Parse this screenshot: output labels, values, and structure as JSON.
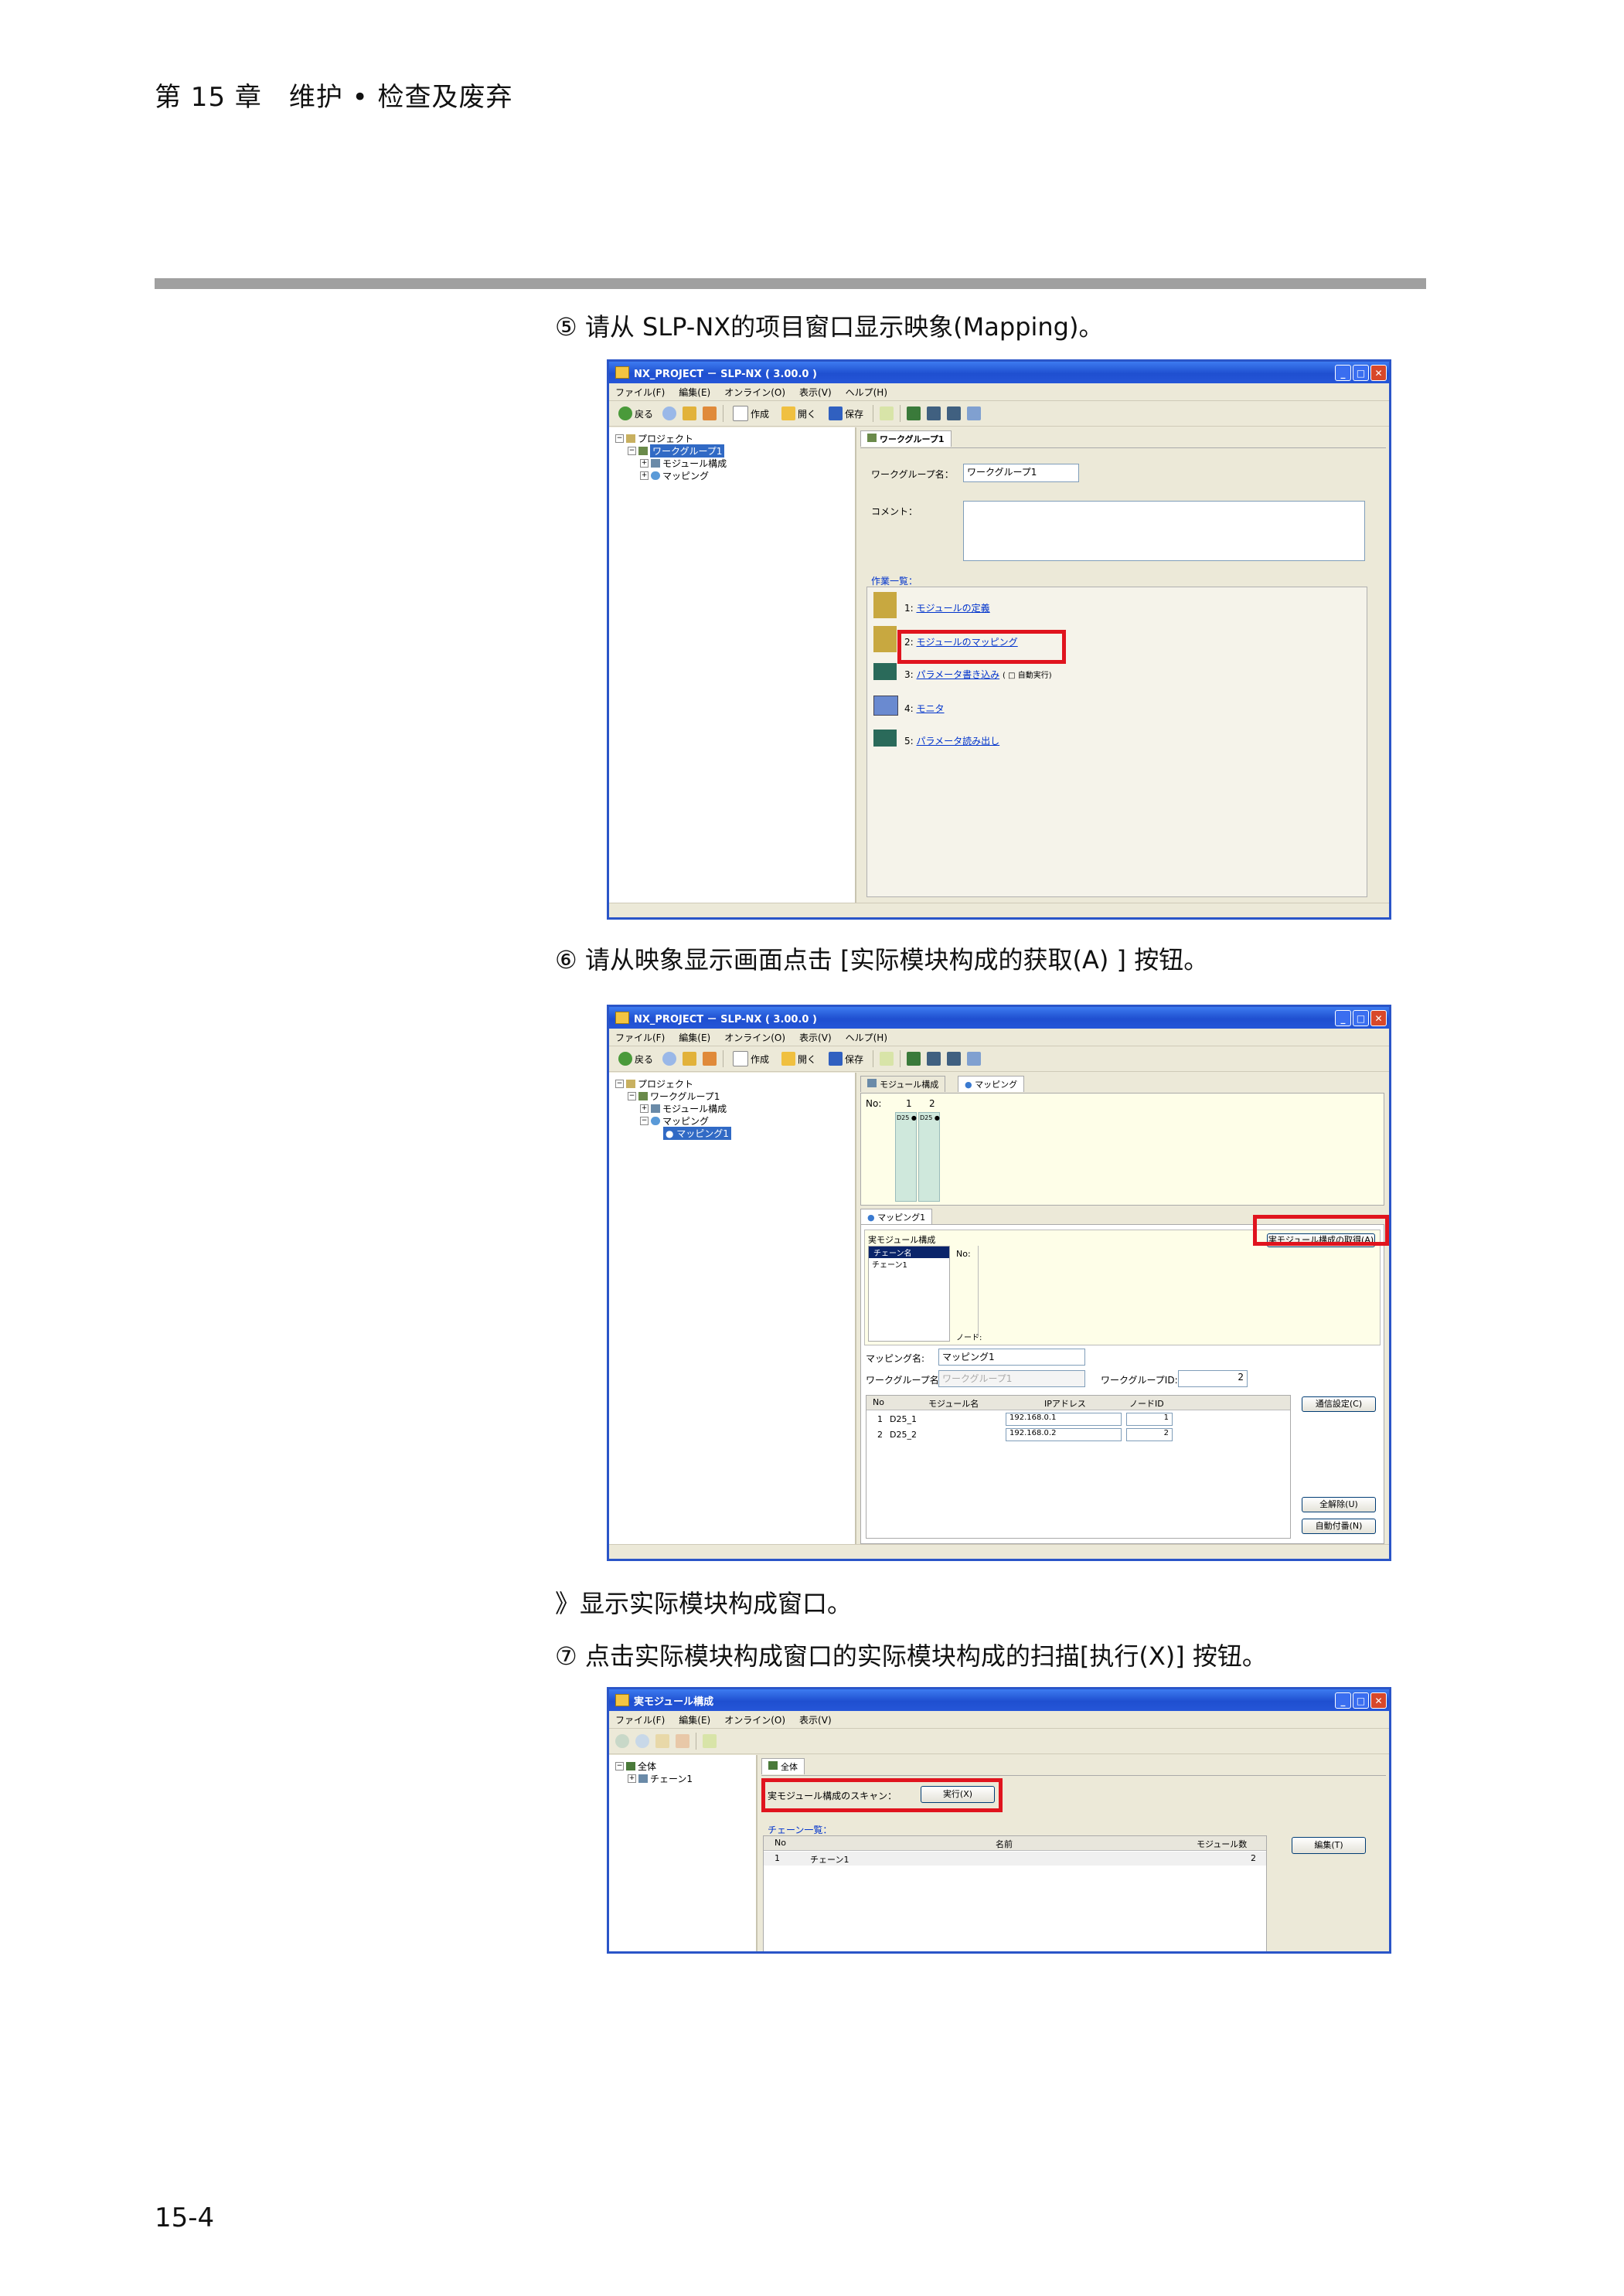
{
  "header": {
    "chapter": "第 15 章　维护 • 检查及废弃"
  },
  "steps": {
    "s5": "⑤ 请从 SLP-NX的项目窗口显示映象(Mapping)。",
    "s6": "⑥ 请从映象显示画面点击 [实际模块构成的获取(A) ] 按钮。",
    "result": "》显示实际模块构成窗口。",
    "s7": "⑦ 点击实际模块构成窗口的实际模块构成的扫描[执行(X)] 按钮。"
  },
  "screen1": {
    "title": "NX_PROJECT － SLP-NX ( 3.00.0 )",
    "menu": [
      "ファイル(F)",
      "編集(E)",
      "オンライン(O)",
      "表示(V)",
      "ヘルプ(H)"
    ],
    "toolbar": {
      "back": "戻る",
      "create": "作成",
      "open": "開く",
      "save": "保存"
    },
    "tree": [
      "プロジェクト",
      "ワークグループ1",
      "モジュール構成",
      "マッピング"
    ],
    "panel_title": "ワークグループ1",
    "name_label": "ワークグループ名：",
    "name_value": "ワークグループ1",
    "comment_label": "コメント：",
    "tasks_label": "作業一覧：",
    "tasks": [
      {
        "num": "1:",
        "text": "モジュールの定義",
        "extra": ""
      },
      {
        "num": "2:",
        "text": "モジュールのマッピング",
        "extra": ""
      },
      {
        "num": "3:",
        "text": "パラメータ書き込み",
        "extra": "( □ 自動実行)"
      },
      {
        "num": "4:",
        "text": "モニタ",
        "extra": ""
      },
      {
        "num": "5:",
        "text": "パラメータ読み出し",
        "extra": ""
      }
    ]
  },
  "screen2": {
    "title": "NX_PROJECT － SLP-NX ( 3.00.0 )",
    "menu": [
      "ファイル(F)",
      "編集(E)",
      "オンライン(O)",
      "表示(V)",
      "ヘルプ(H)"
    ],
    "toolbar": {
      "back": "戻る",
      "create": "作成",
      "open": "開く",
      "save": "保存"
    },
    "tree": [
      "プロジェクト",
      "ワークグループ1",
      "モジュール構成",
      "マッピング",
      "マッピング1"
    ],
    "tabs": [
      "モジュール構成",
      "マッピング"
    ],
    "no_label": "No:",
    "slots": [
      "1",
      "2"
    ],
    "slot_tags": [
      "D25 ●",
      "D25 ●"
    ],
    "mapping_tab": "マッピング1",
    "real_module_label": "実モジュール構成",
    "acquire_button": "実モジュール構成の取得(A)",
    "chain_header": "チェーン名",
    "chain_item": "チェーン1",
    "node_label": "ノード:",
    "mapping_name_label": "マッピング名:",
    "mapping_name_value": "マッピング1",
    "workgroup_name_label": "ワークグループ名:",
    "workgroup_name_value": "ワークグループ1",
    "workgroup_id_label": "ワークグループID:",
    "workgroup_id_value": "2",
    "table_headers": [
      "No",
      "モジュール名",
      "IPアドレス",
      "ノードID"
    ],
    "table_rows": [
      [
        "1",
        "D25_1",
        "192.168.0.1",
        "1"
      ],
      [
        "2",
        "D25_2",
        "192.168.0.2",
        "2"
      ]
    ],
    "buttons": [
      "通信設定(C)",
      "全解除(U)",
      "自動付番(N)"
    ]
  },
  "screen3": {
    "title": "実モジュール構成",
    "menu": [
      "ファイル(F)",
      "編集(E)",
      "オンライン(O)",
      "表示(V)"
    ],
    "tree": [
      "全体",
      "チェーン1"
    ],
    "tab": "全体",
    "scan_label": "実モジュール構成のスキャン：",
    "execute_button": "実行(X)",
    "chain_list_label": "チェーン一覧：",
    "headers": [
      "No",
      "名前",
      "モジュール数"
    ],
    "rows": [
      [
        "1",
        "チェーン1",
        "2"
      ]
    ],
    "edit_button": "編集(T)"
  },
  "page_number": "15-4",
  "colors": {
    "highlight_box": "#e0141e",
    "titlebar": "#2556d8",
    "rule": "#a0a0a0"
  }
}
